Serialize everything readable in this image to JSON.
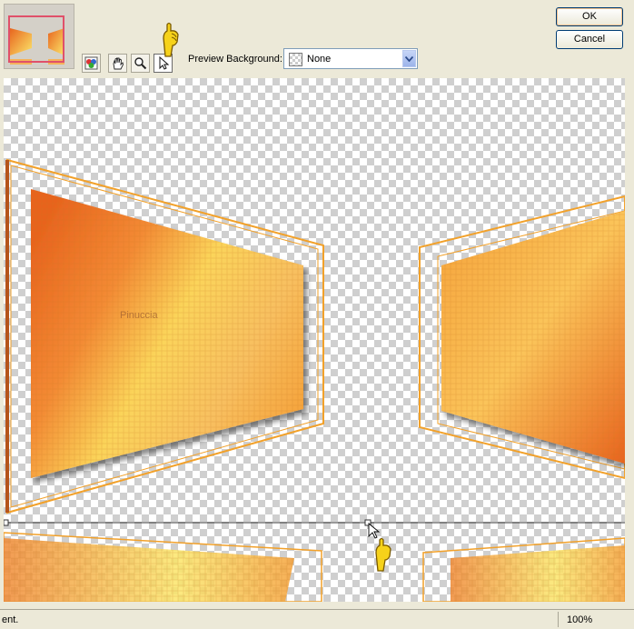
{
  "dialog": {
    "ok_label": "OK",
    "cancel_label": "Cancel"
  },
  "toolbar": {
    "tools": [
      {
        "name": "color-picker-icon",
        "active": false
      },
      {
        "name": "pan-hand-icon",
        "active": false
      },
      {
        "name": "zoom-icon",
        "active": false
      },
      {
        "name": "pointer-arrow-icon",
        "active": true
      }
    ],
    "preview_background_label": "Preview Background:",
    "preview_background_value": "None"
  },
  "canvas": {
    "watermark_text": "Pinuccia"
  },
  "status": {
    "text": "ent.",
    "zoom": "100%"
  },
  "colors": {
    "orange_dark": "#e8641e",
    "orange": "#f5a23a",
    "yellow": "#fbe66a",
    "frame_line": "#f2a12a",
    "selection": "#e0506a"
  }
}
